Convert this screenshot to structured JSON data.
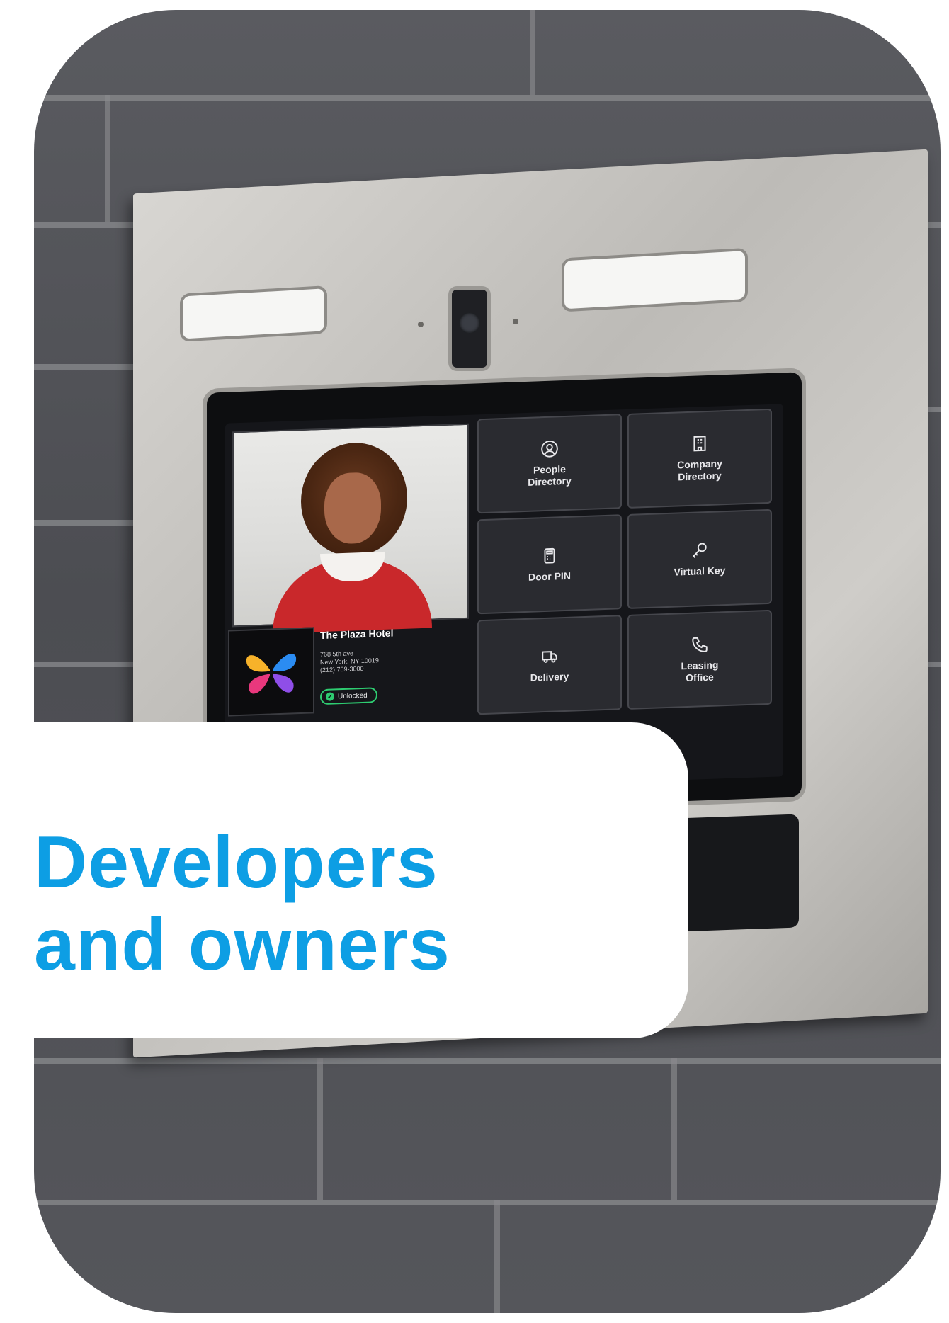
{
  "heading": {
    "line1": "Developers",
    "line2": "and owners",
    "color": "#0d9ee4"
  },
  "device": {
    "photo": {
      "subject": "smiling woman in red sweater"
    },
    "property": {
      "name": "The Plaza Hotel",
      "address_line1": "768 5th ave",
      "address_line2": "New York, NY 10019",
      "phone": "(212) 759-3000",
      "status": "Unlocked"
    },
    "tiles": [
      {
        "label": "People\nDirectory",
        "icon": "person-circle-icon"
      },
      {
        "label": "Company\nDirectory",
        "icon": "building-icon"
      },
      {
        "label": "Door PIN",
        "icon": "keypad-icon"
      },
      {
        "label": "Virtual Key",
        "icon": "key-icon"
      },
      {
        "label": "Delivery",
        "icon": "truck-icon"
      },
      {
        "label": "Leasing\nOffice",
        "icon": "phone-icon"
      }
    ],
    "accent": "#2ecc71"
  }
}
